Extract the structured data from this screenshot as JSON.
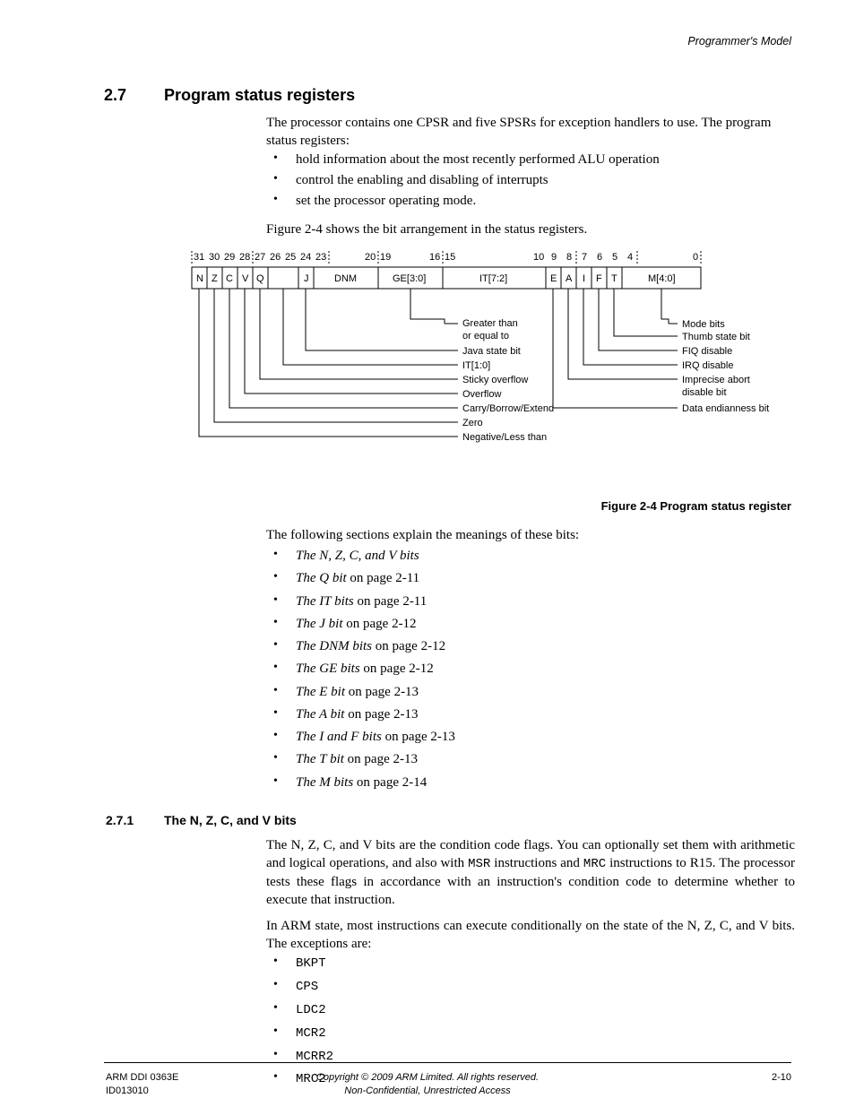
{
  "runningHead": "Programmer's Model",
  "section": {
    "num": "2.7",
    "title": "Program status registers"
  },
  "intro1": "The processor contains one CPSR and five SPSRs for exception handlers to use. The program status registers:",
  "introBullets": [
    "hold information about the most recently performed ALU operation",
    "control the enabling and disabling of interrupts",
    "set the processor operating mode."
  ],
  "intro2": "Figure 2-4 shows the bit arrangement in the status registers.",
  "figure": {
    "bitTicks": [
      "31",
      "30",
      "29",
      "28",
      "27",
      "26",
      "25",
      "24",
      "23",
      "20",
      "19",
      "16",
      "15",
      "10",
      "9",
      "8",
      "7",
      "6",
      "5",
      "4",
      "0"
    ],
    "fields": [
      "N",
      "Z",
      "C",
      "V",
      "Q",
      "",
      "J",
      "DNM",
      "GE[3:0]",
      "IT[7:2]",
      "E",
      "A",
      "I",
      "F",
      "T",
      "M[4:0]"
    ],
    "leftLabels": [
      "Greater than or equal to",
      "Java state bit",
      "IT[1:0]",
      "Sticky overflow",
      "Overflow",
      "Carry/Borrow/Extend",
      "Zero",
      "Negative/Less than"
    ],
    "rightLabels": [
      "Mode bits",
      "Thumb state bit",
      "FIQ disable",
      "IRQ disable",
      "Imprecise abort disable bit",
      "Data endianness bit"
    ]
  },
  "figCaption": "Figure 2-4 Program status register",
  "intro3": "The following sections explain the meanings of these bits:",
  "links": [
    {
      "title": "The N, Z, C, and V bits",
      "suffix": ""
    },
    {
      "title": "The Q bit",
      "suffix": " on page 2-11"
    },
    {
      "title": "The IT bits",
      "suffix": " on page 2-11"
    },
    {
      "title": "The J bit",
      "suffix": " on page 2-12"
    },
    {
      "title": "The DNM bits",
      "suffix": " on page 2-12"
    },
    {
      "title": "The GE bits",
      "suffix": " on page 2-12"
    },
    {
      "title": "The E bit",
      "suffix": " on page 2-13"
    },
    {
      "title": "The A bit",
      "suffix": " on page 2-13"
    },
    {
      "title": "The I and F bits",
      "suffix": " on page 2-13"
    },
    {
      "title": "The T bit",
      "suffix": " on page 2-13"
    },
    {
      "title": "The M bits",
      "suffix": " on page 2-14"
    }
  ],
  "subsection": {
    "num": "2.7.1",
    "title": "The N, Z, C, and V bits"
  },
  "para271a_pre": "The N, Z, C, and V bits are the condition code flags. You can optionally set them with arithmetic and logical operations, and also with ",
  "para271a_msr": "MSR",
  "para271a_mid": " instructions and ",
  "para271a_mrc": "MRC",
  "para271a_post": " instructions to R15. The processor tests these flags in accordance with an instruction's condition code to determine whether to execute that instruction.",
  "para271b": "In ARM state, most instructions can execute conditionally on the state of the N, Z, C, and V bits. The exceptions are:",
  "monoList": [
    "BKPT",
    "CPS",
    "LDC2",
    "MCR2",
    "MCRR2",
    "MRC2"
  ],
  "footer": {
    "leftLine1": "ARM DDI 0363E",
    "leftLine2": "ID013010",
    "centerLine1": "Copyright © 2009 ARM Limited. All rights reserved.",
    "centerLine2": "Non-Confidential, Unrestricted Access",
    "right": "2-10"
  }
}
